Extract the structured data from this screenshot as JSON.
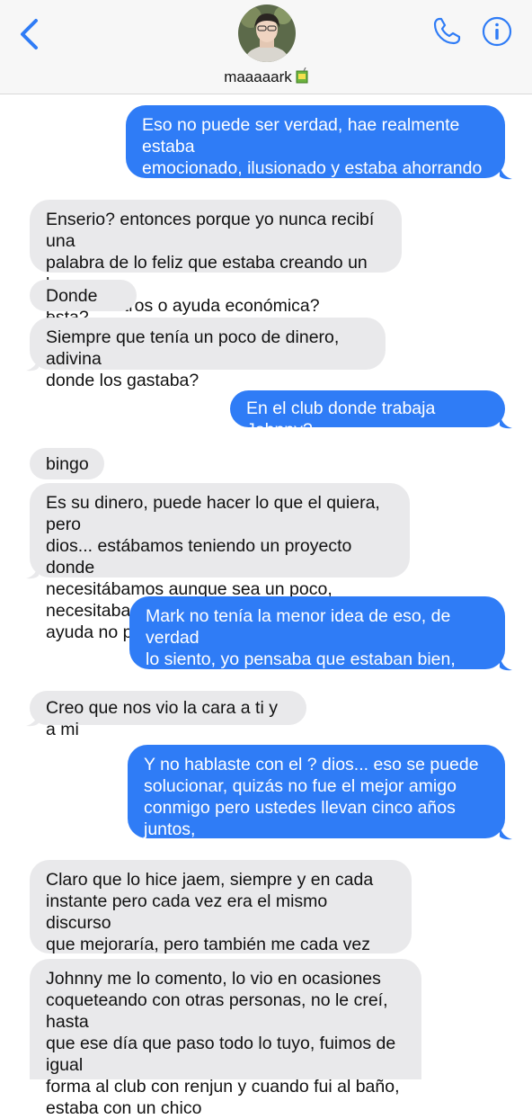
{
  "header": {
    "contact_name": "maaaaark",
    "contact_emoji": "🧃"
  },
  "colors": {
    "sent": "#2f7cf6",
    "received": "#e9e9eb",
    "accent": "#2f7cf6"
  },
  "icons": {
    "back": "chevron-left-icon",
    "call": "phone-icon",
    "info": "info-icon"
  },
  "messages": [
    {
      "from": "me",
      "text": "Eso no puede ser verdad, hae realmente estaba\nemocionado, ilusionado y estaba ahorrando\ndinero"
    },
    {
      "from": "them",
      "text": "Enserio? entonces porque yo nunca recibí una\npalabra de lo feliz que estaba creando un hogar\npara nosotros o ayuda económica?"
    },
    {
      "from": "them",
      "text": "Donde esta?"
    },
    {
      "from": "them",
      "text": "Siempre que tenía un poco de dinero, adivina\ndonde los gastaba?"
    },
    {
      "from": "me",
      "text": "En el club donde trabaja Johnny?"
    },
    {
      "from": "them",
      "text": "bingo"
    },
    {
      "from": "them",
      "text": "Es su dinero, puede hacer lo que el quiera, pero\ndios... estábamos teniendo un proyecto donde\nnecesitábamos aunque sea un poco, necesitaba\nayuda no podía solo"
    },
    {
      "from": "me",
      "text": "Mark no tenía la menor idea de eso, de verdad\nlo siento, yo pensaba que estaban bien, hae me\nhabía dicho cosas distintas"
    },
    {
      "from": "them",
      "text": "Creo que nos vio la cara a ti y a mi"
    },
    {
      "from": "me",
      "text": "Y no hablaste con el ? dios... eso se puede\nsolucionar, quizás no fue el mejor amigo\nconmigo pero ustedes llevan cinco años juntos,\nhay mucho más juego"
    },
    {
      "from": "them",
      "text": "Claro que lo hice jaem, siempre y en cada\ninstante pero cada vez era el mismo discurso\nque mejoraría, pero también me cada vez me iba\nsorprendiendo más y más de quién era"
    },
    {
      "from": "them",
      "text": "Johnny me lo comento, lo vio en ocasiones\ncoqueteando con otras personas, no le creí, hasta\nque ese día que paso todo lo tuyo, fuimos de igual\nforma al club con renjun y cuando fui al baño,\nestaba con un chico"
    }
  ]
}
